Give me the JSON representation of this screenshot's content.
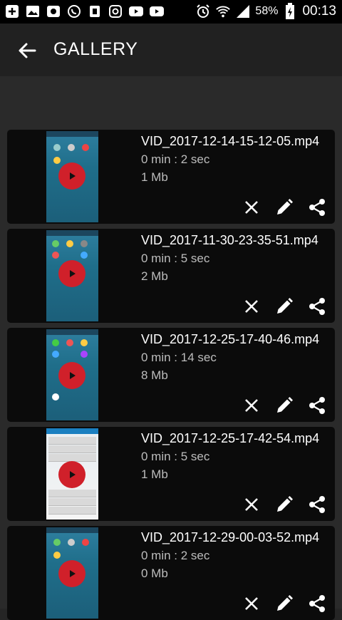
{
  "status_bar": {
    "battery": "58%",
    "time": "00:13",
    "left_icons": [
      "add-box-icon",
      "image-icon",
      "video-recorder-icon",
      "whatsapp-icon",
      "battery-saver-icon",
      "instagram-icon",
      "youtube-icon",
      "youtube-icon"
    ],
    "right_icons": [
      "alarm-icon",
      "wifi-icon",
      "signal-icon",
      "battery-icon"
    ]
  },
  "app_bar": {
    "title": "GALLERY",
    "back_icon": "arrow-back-icon"
  },
  "videos": [
    {
      "filename": "VID_2017-12-14-15-12-05.mp4",
      "duration": "0 min : 2 sec",
      "size": "1 Mb"
    },
    {
      "filename": "VID_2017-11-30-23-35-51.mp4",
      "duration": "0 min : 5 sec",
      "size": "2 Mb"
    },
    {
      "filename": "VID_2017-12-25-17-40-46.mp4",
      "duration": "0 min : 14 sec",
      "size": "8 Mb"
    },
    {
      "filename": "VID_2017-12-25-17-42-54.mp4",
      "duration": "0 min : 5 sec",
      "size": "1 Mb"
    },
    {
      "filename": "VID_2017-12-29-00-03-52.mp4",
      "duration": "0 min : 2 sec",
      "size": "0 Mb"
    }
  ],
  "card_actions": [
    "close-icon",
    "edit-pencil-icon",
    "share-icon"
  ],
  "colors": {
    "accent_play": "#d0202a",
    "card_bg": "#0b0b0b",
    "app_bar_bg": "#212121"
  }
}
